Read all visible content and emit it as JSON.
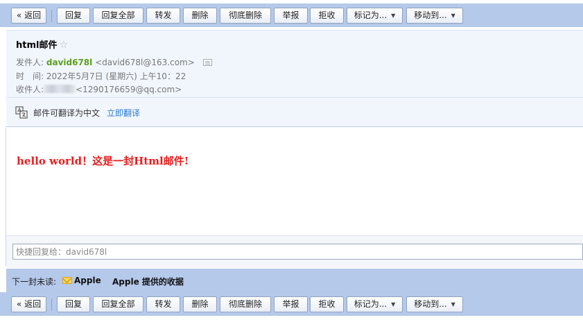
{
  "toolbar": {
    "back": "« 返回",
    "reply": "回复",
    "reply_all": "回复全部",
    "forward": "转发",
    "delete": "删除",
    "delete_forever": "彻底删除",
    "report": "举报",
    "reject": "拒收",
    "mark_as": "标记为...",
    "move_to": "移动到..."
  },
  "mail": {
    "subject": "html邮件",
    "star": "☆",
    "from_label": "发件人:",
    "from_name": "david678l",
    "from_email": "<david678l@163.com>",
    "time_label": "时　间:",
    "time_value": "2022年5月7日 (星期六) 上午10：22",
    "to_label": "收件人:",
    "to_email": "<1290176659@qq.com>",
    "translate_notice": "邮件可翻译为中文",
    "translate_link": "立即翻译",
    "body": "hello world！这是一封Html邮件!"
  },
  "quick_reply": {
    "placeholder": "快捷回复给：david678l"
  },
  "next_unread": {
    "label": "下一封未读:",
    "sender": "Apple",
    "subject": "Apple 提供的收据"
  },
  "colors": {
    "toolbar_bg": "#b5c9ea",
    "sender_name": "#5c9e1c",
    "body_text": "#e51e1e",
    "link": "#2c7bd0"
  },
  "icons": {
    "contact_card": "contact-card-icon",
    "translate": "translate-icon",
    "envelope": "envelope-icon",
    "dropdown": "chevron-down-icon"
  }
}
